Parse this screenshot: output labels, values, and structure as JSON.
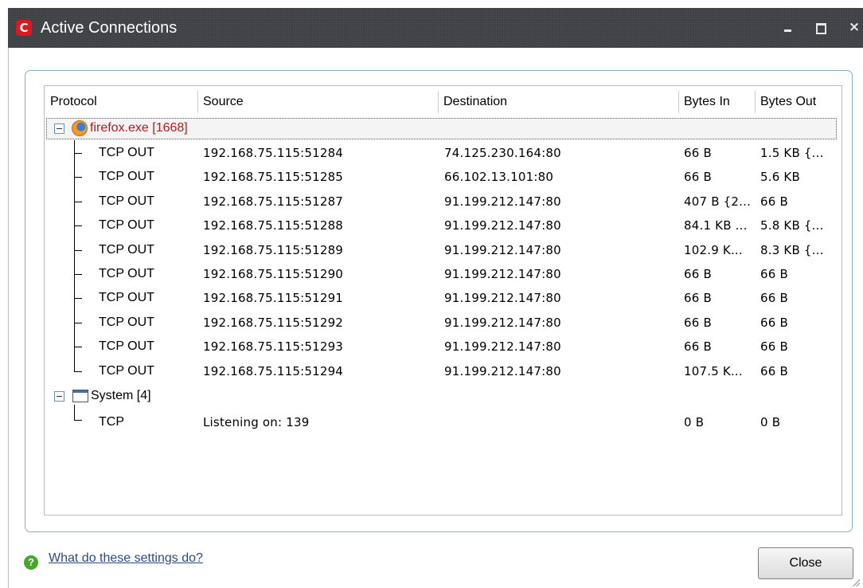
{
  "window": {
    "title": "Active Connections",
    "logo_letter": "C",
    "controls": {
      "minimize": "",
      "maximize": "",
      "close": "×"
    }
  },
  "table": {
    "columns": [
      "Protocol",
      "Source",
      "Destination",
      "Bytes In",
      "Bytes Out"
    ],
    "groups": [
      {
        "name": "firefox.exe [1668]",
        "icon": "firefox-icon",
        "rows": [
          {
            "protocol": "TCP OUT",
            "source": "192.168.75.115:51284",
            "destination": "74.125.230.164:80",
            "bytes_in": "66 B",
            "bytes_out": "1.5 KB {..."
          },
          {
            "protocol": "TCP OUT",
            "source": "192.168.75.115:51285",
            "destination": "66.102.13.101:80",
            "bytes_in": "66 B",
            "bytes_out": "5.6 KB"
          },
          {
            "protocol": "TCP OUT",
            "source": "192.168.75.115:51287",
            "destination": "91.199.212.147:80",
            "bytes_in": "407 B {2...",
            "bytes_out": "66 B"
          },
          {
            "protocol": "TCP OUT",
            "source": "192.168.75.115:51288",
            "destination": "91.199.212.147:80",
            "bytes_in": "84.1 KB ...",
            "bytes_out": "5.8 KB {..."
          },
          {
            "protocol": "TCP OUT",
            "source": "192.168.75.115:51289",
            "destination": "91.199.212.147:80",
            "bytes_in": "102.9 K...",
            "bytes_out": "8.3 KB {..."
          },
          {
            "protocol": "TCP OUT",
            "source": "192.168.75.115:51290",
            "destination": "91.199.212.147:80",
            "bytes_in": "66 B",
            "bytes_out": "66 B"
          },
          {
            "protocol": "TCP OUT",
            "source": "192.168.75.115:51291",
            "destination": "91.199.212.147:80",
            "bytes_in": "66 B",
            "bytes_out": "66 B"
          },
          {
            "protocol": "TCP OUT",
            "source": "192.168.75.115:51292",
            "destination": "91.199.212.147:80",
            "bytes_in": "66 B",
            "bytes_out": "66 B"
          },
          {
            "protocol": "TCP OUT",
            "source": "192.168.75.115:51293",
            "destination": "91.199.212.147:80",
            "bytes_in": "66 B",
            "bytes_out": "66 B"
          },
          {
            "protocol": "TCP OUT",
            "source": "192.168.75.115:51294",
            "destination": "91.199.212.147:80",
            "bytes_in": "107.5 K...",
            "bytes_out": "66 B"
          }
        ]
      },
      {
        "name": "System [4]",
        "icon": "window-icon",
        "rows": [
          {
            "protocol": "TCP",
            "source": "Listening on: 139",
            "destination": "",
            "bytes_in": "0 B",
            "bytes_out": "0 B"
          }
        ]
      }
    ]
  },
  "footer": {
    "help_link": "What do these settings do?",
    "close_button": "Close"
  },
  "colors": {
    "titlebar": "#3e4046",
    "process_name": "#c0151b",
    "link": "#2b4a83",
    "logo": "#d9181f"
  }
}
